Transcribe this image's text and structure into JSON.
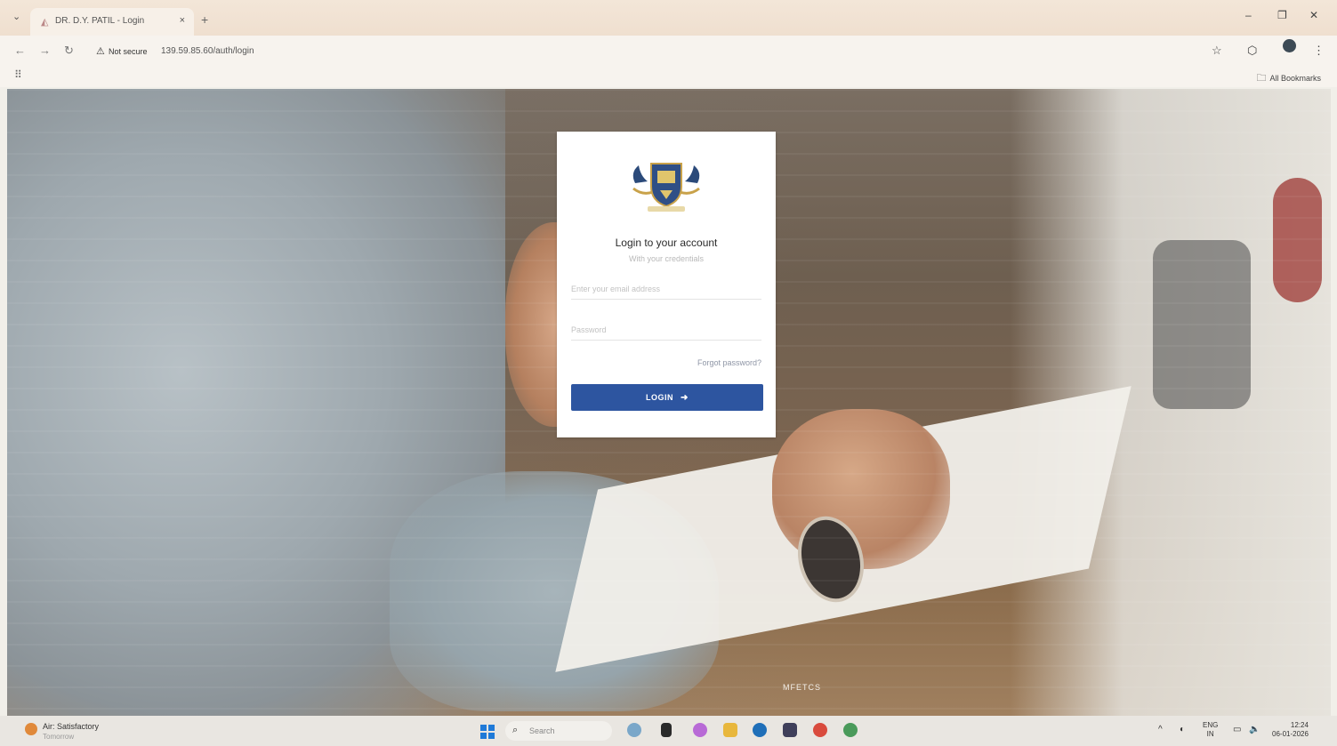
{
  "browser": {
    "tab_title": "DR. D.Y. PATIL - Login",
    "tab_close": "×",
    "new_tab": "+",
    "security_label": "Not secure",
    "url": "139.59.85.60/auth/login",
    "bookmarks_label": "All Bookmarks",
    "window": {
      "minimize": "–",
      "restore": "❐",
      "close": "✕"
    }
  },
  "login": {
    "title": "Login to your account",
    "subtitle": "With your credentials",
    "email_placeholder": "Enter your email address",
    "password_placeholder": "Password",
    "forgot_label": "Forgot password?",
    "button_label": "LOGIN",
    "button_icon": "arrow-right-icon"
  },
  "page": {
    "footer_text": "MFETCS"
  },
  "taskbar": {
    "weather_title": "Air: Satisfactory",
    "weather_sub": "Tomorrow",
    "search_placeholder": "Search",
    "language": "ENG",
    "region": "IN",
    "time": "12:24",
    "date": "06-01-2026"
  },
  "colors": {
    "primary_button": "#2d55a0",
    "card_background": "#ffffff",
    "tab_strip": "#f3e6d8"
  }
}
